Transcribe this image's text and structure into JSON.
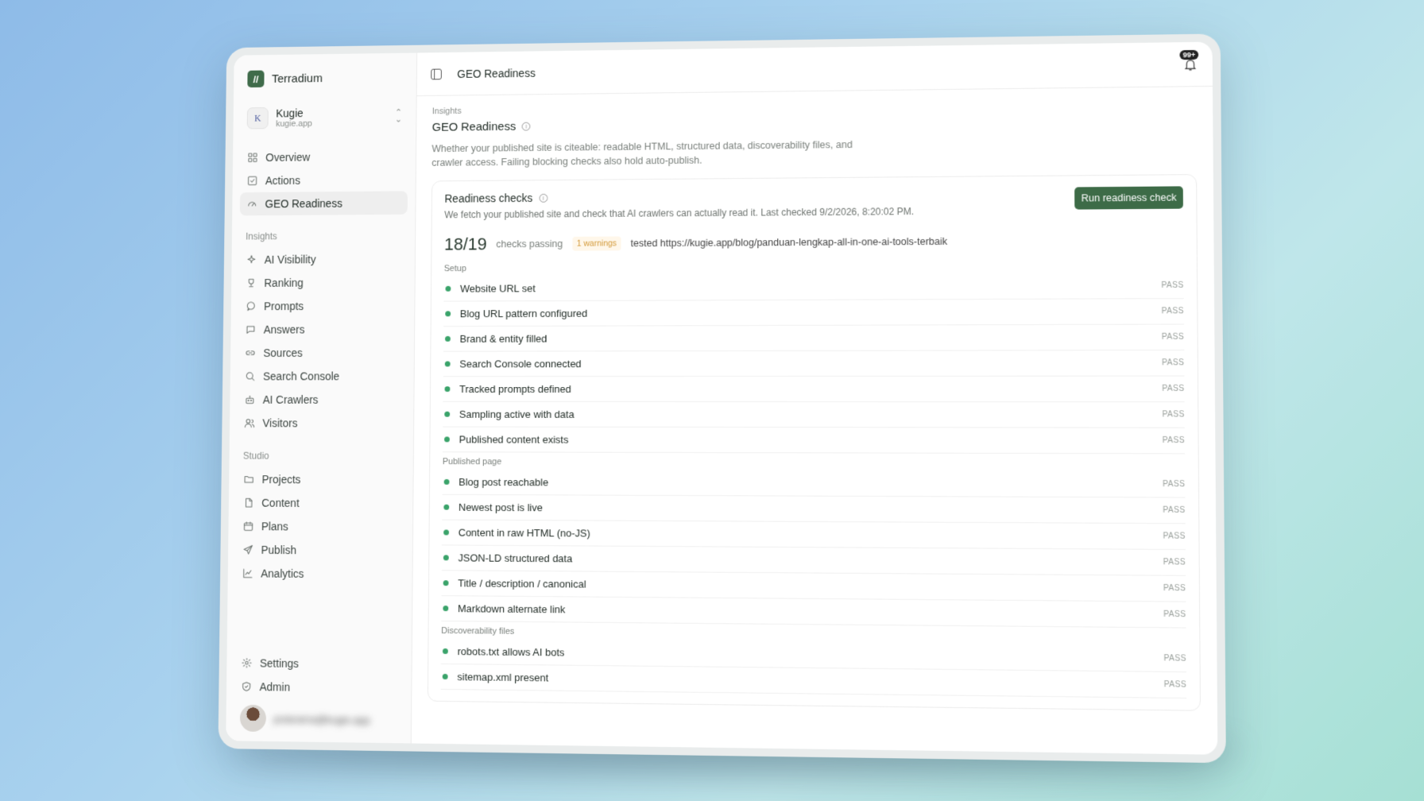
{
  "brand": {
    "name": "Terradium",
    "logo": "//"
  },
  "workspace": {
    "initial": "K",
    "name": "Kugie",
    "domain": "kugie.app"
  },
  "nav": {
    "main": [
      {
        "label": "Overview",
        "icon": "grid-icon"
      },
      {
        "label": "Actions",
        "icon": "checkbox-icon"
      },
      {
        "label": "GEO Readiness",
        "icon": "gauge-icon",
        "active": true
      }
    ],
    "insights_label": "Insights",
    "insights": [
      {
        "label": "AI Visibility",
        "icon": "sparkle-icon"
      },
      {
        "label": "Ranking",
        "icon": "trophy-icon"
      },
      {
        "label": "Prompts",
        "icon": "chat-icon"
      },
      {
        "label": "Answers",
        "icon": "message-icon"
      },
      {
        "label": "Sources",
        "icon": "link-icon"
      },
      {
        "label": "Search Console",
        "icon": "search-icon"
      },
      {
        "label": "AI Crawlers",
        "icon": "bot-icon"
      },
      {
        "label": "Visitors",
        "icon": "users-icon"
      }
    ],
    "studio_label": "Studio",
    "studio": [
      {
        "label": "Projects",
        "icon": "folder-icon"
      },
      {
        "label": "Content",
        "icon": "file-icon"
      },
      {
        "label": "Plans",
        "icon": "calendar-icon"
      },
      {
        "label": "Publish",
        "icon": "send-icon"
      },
      {
        "label": "Analytics",
        "icon": "chart-icon"
      }
    ],
    "bottom": [
      {
        "label": "Settings",
        "icon": "gear-icon"
      },
      {
        "label": "Admin",
        "icon": "shield-icon"
      }
    ]
  },
  "user": {
    "email": "putarama@kugie.app"
  },
  "topbar": {
    "title": "GEO Readiness",
    "badge": "99+"
  },
  "page": {
    "crumb": "Insights",
    "title": "GEO Readiness",
    "description": "Whether your published site is citeable: readable HTML, structured data, discoverability files, and crawler access. Failing blocking checks also hold auto-publish."
  },
  "card": {
    "title": "Readiness checks",
    "subtitle": "We fetch your published site and check that AI crawlers can actually read it. Last checked 9/2/2026, 8:20:02 PM.",
    "button": "Run readiness check",
    "score": "18/19",
    "passing_label": "checks passing",
    "warnings": "1 warnings",
    "tested": "tested https://kugie.app/blog/panduan-lengkap-all-in-one-ai-tools-terbaik"
  },
  "sections": [
    {
      "label": "Setup",
      "rows": [
        {
          "label": "Website URL set",
          "status": "PASS"
        },
        {
          "label": "Blog URL pattern configured",
          "status": "PASS"
        },
        {
          "label": "Brand & entity filled",
          "status": "PASS"
        },
        {
          "label": "Search Console connected",
          "status": "PASS"
        },
        {
          "label": "Tracked prompts defined",
          "status": "PASS"
        },
        {
          "label": "Sampling active with data",
          "status": "PASS"
        },
        {
          "label": "Published content exists",
          "status": "PASS"
        }
      ]
    },
    {
      "label": "Published page",
      "rows": [
        {
          "label": "Blog post reachable",
          "status": "PASS"
        },
        {
          "label": "Newest post is live",
          "status": "PASS"
        },
        {
          "label": "Content in raw HTML (no-JS)",
          "status": "PASS"
        },
        {
          "label": "JSON-LD structured data",
          "status": "PASS"
        },
        {
          "label": "Title / description / canonical",
          "status": "PASS"
        },
        {
          "label": "Markdown alternate link",
          "status": "PASS"
        }
      ]
    },
    {
      "label": "Discoverability files",
      "rows": [
        {
          "label": "robots.txt allows AI bots",
          "status": "PASS"
        },
        {
          "label": "sitemap.xml present",
          "status": "PASS"
        }
      ]
    }
  ],
  "colors": {
    "accent": "#3d6b47",
    "pass_dot": "#3aa36a",
    "warning": "#d39a3a"
  }
}
